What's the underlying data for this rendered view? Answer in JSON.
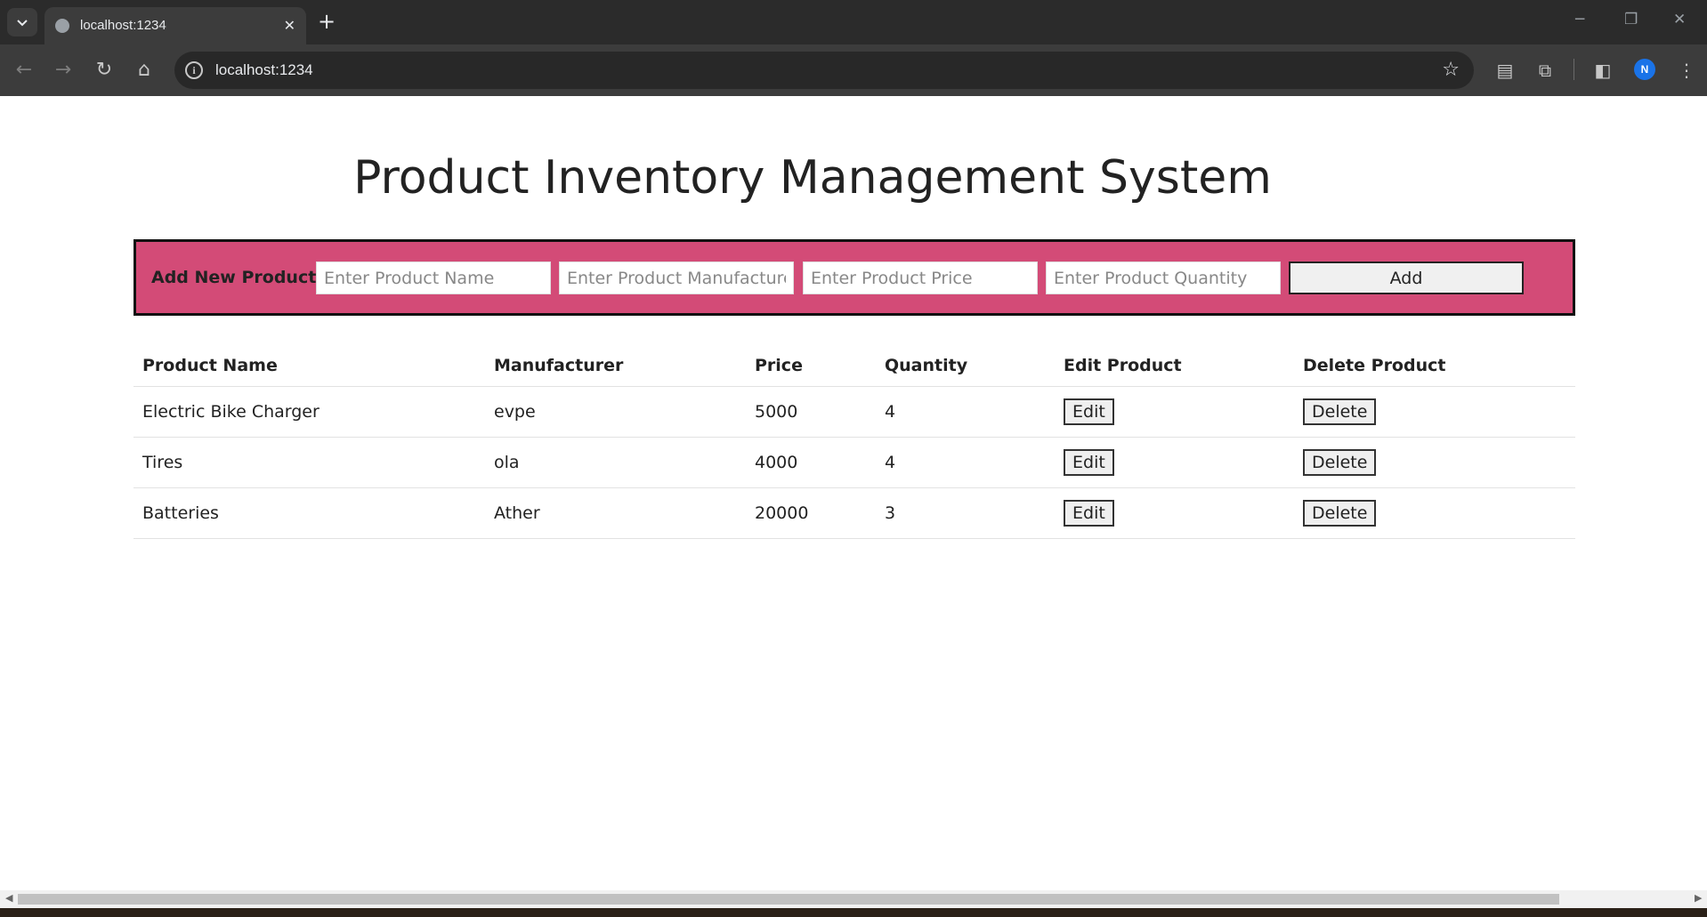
{
  "browser": {
    "tab_title": "localhost:1234",
    "tab_close": "✕",
    "new_tab": "+",
    "url": "localhost:1234",
    "profile_initial": "N",
    "icons": {
      "tab_search": "chevron-down-icon",
      "back": "back-arrow-icon",
      "forward": "forward-arrow-icon",
      "reload": "reload-icon",
      "home": "home-icon",
      "info": "info-icon",
      "bookmark": "star-icon",
      "extensions": "puzzle-icon",
      "sidepanel": "sidepanel-icon",
      "menu": "kebab-menu-icon"
    }
  },
  "page": {
    "title": "Product Inventory Management System",
    "add_form": {
      "label": "Add New Product:",
      "name_placeholder": "Enter Product Name",
      "manufacturer_placeholder": "Enter Product Manufacturer",
      "price_placeholder": "Enter Product Price",
      "quantity_placeholder": "Enter Product Quantity",
      "add_label": "Add"
    },
    "table": {
      "headers": [
        "Product Name",
        "Manufacturer",
        "Price",
        "Quantity",
        "Edit Product",
        "Delete Product"
      ],
      "rows": [
        {
          "name": "Electric Bike Charger",
          "manufacturer": "evpe",
          "price": "5000",
          "quantity": "4",
          "edit": "Edit",
          "delete": "Delete"
        },
        {
          "name": "Tires",
          "manufacturer": "ola",
          "price": "4000",
          "quantity": "4",
          "edit": "Edit",
          "delete": "Delete"
        },
        {
          "name": "Batteries",
          "manufacturer": "Ather",
          "price": "20000",
          "quantity": "3",
          "edit": "Edit",
          "delete": "Delete"
        }
      ]
    }
  },
  "colors": {
    "panel_bg": "#d34b77",
    "chrome_dark": "#2b2b2b",
    "chrome_toolbar": "#3c3c3c"
  }
}
